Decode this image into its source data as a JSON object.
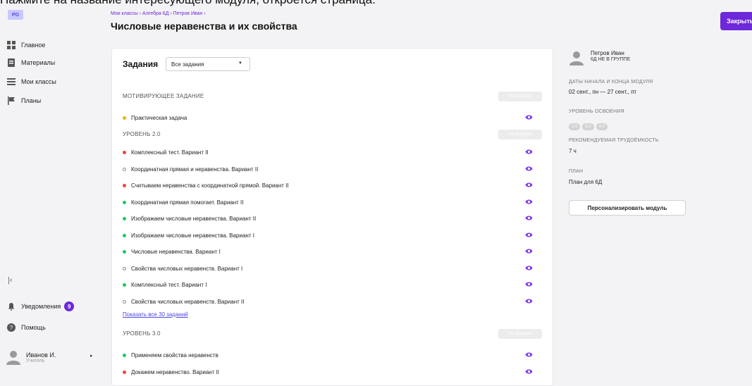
{
  "instruction": "Нажмите на название интересующего модуля, откроется страница.",
  "sidebar": {
    "logo": "PG",
    "items": [
      {
        "label": "Главное",
        "icon": "dashboard-icon"
      },
      {
        "label": "Материалы",
        "icon": "book-icon"
      },
      {
        "label": "Мои классы",
        "icon": "classes-icon"
      },
      {
        "label": "Планы",
        "icon": "flag-icon"
      }
    ],
    "notifications": {
      "label": "Уведомления",
      "count": "9"
    },
    "help": "Помощь",
    "user": {
      "name": "Иванов И.",
      "role": "Учитель"
    }
  },
  "header": {
    "breadcrumbs": [
      "Мои классы",
      "Алгебра 6Д",
      "Петров Иван"
    ],
    "title": "Числовые неравенства и их свойства",
    "close_label": "Закрыть"
  },
  "tasks": {
    "label": "Задания",
    "filter": "Все задания",
    "show_all": "Показать все 30 заданий",
    "sections": [
      {
        "title": "МОТИВИРУЮЩЕЕ ЗАДАНИЕ",
        "badge": "Не пройден",
        "rows": [
          {
            "title": "Практическая задача",
            "status": "yellow"
          }
        ]
      },
      {
        "title": "УРОВЕНЬ 2.0",
        "badge": "Не пройден",
        "rows": [
          {
            "title": "Комплексный тест. Вариант II",
            "status": "red"
          },
          {
            "title": "Координатная прямая и неравенства. Вариант II",
            "status": "empty"
          },
          {
            "title": "Считываем неравенства с координатной прямой. Вариант II",
            "status": "red"
          },
          {
            "title": "Координатная прямая помогает. Вариант II",
            "status": "green"
          },
          {
            "title": "Изображаем числовые неравенства. Вариант II",
            "status": "green"
          },
          {
            "title": "Изображаем числовые неравенства. Вариант I",
            "status": "green"
          },
          {
            "title": "Числовые неравенства. Вариант I",
            "status": "green"
          },
          {
            "title": "Свойства числовых неравенств. Вариант I",
            "status": "empty"
          },
          {
            "title": "Комплексный тест. Вариант I",
            "status": "green"
          },
          {
            "title": "Свойства числовых неравенств. Вариант II",
            "status": "empty"
          }
        ]
      },
      {
        "title": "УРОВЕНЬ 3.0",
        "badge": "Не пройден",
        "rows": [
          {
            "title": "Применяем свойства неравенств",
            "status": "green"
          },
          {
            "title": "Докажем неравенство. Вариант II",
            "status": "red"
          }
        ]
      }
    ]
  },
  "panel": {
    "student_name": "Петров Иван",
    "student_group": "6Д НЕ В ГРУППЕ",
    "dates_label": "ДАТЫ НАЧАЛА И КОНЦА МОДУЛЯ",
    "dates_value": "02 сент., пн — 27 сент., пт",
    "level_label": "УРОВЕНЬ ОСВОЕНИЯ",
    "levels": [
      "2.0",
      "3.0",
      "4.0"
    ],
    "effort_label": "РЕКОМЕНДУЕМАЯ ТРУДОЁМКОСТЬ",
    "effort_value": "7 ч",
    "plan_label": "ПЛАН",
    "plan_value": "План для 6Д",
    "personalize_label": "Персонализировать модуль"
  },
  "colors": {
    "accent": "#6d28d9",
    "status_green": "#22c55e",
    "status_red": "#ef4444",
    "status_yellow": "#eab308",
    "eye": "#7c3aed"
  }
}
